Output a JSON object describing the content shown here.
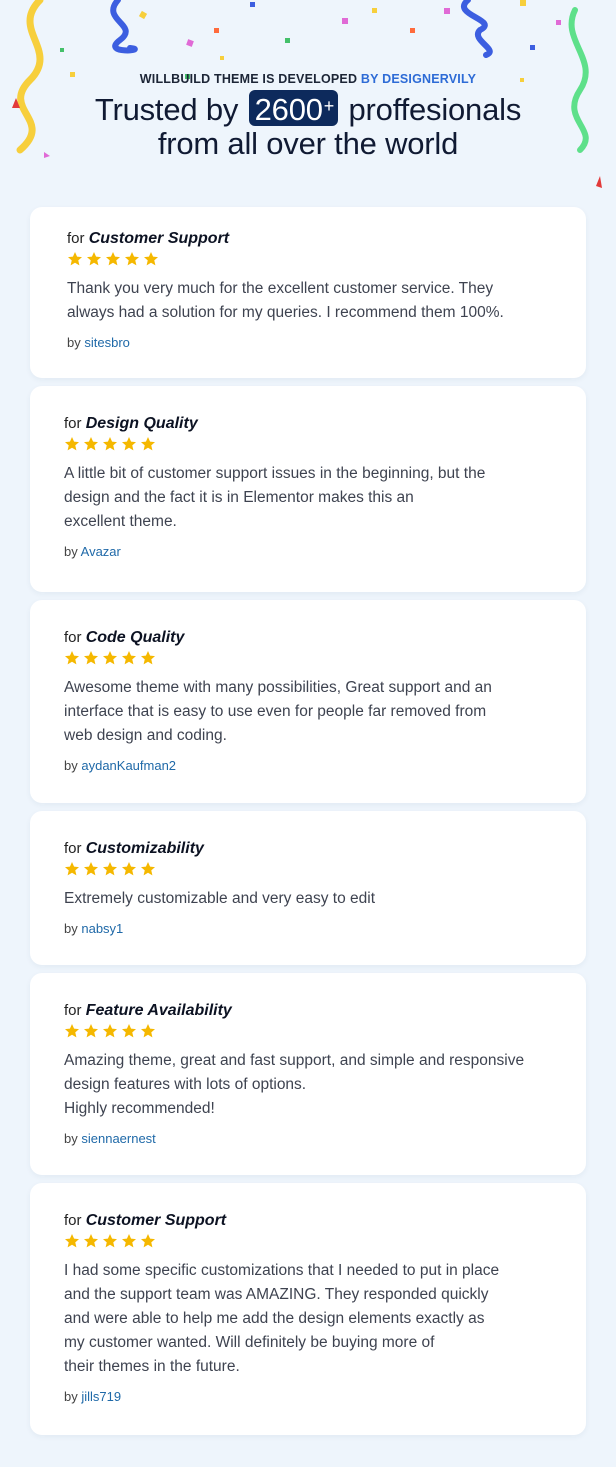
{
  "header": {
    "kicker_prefix": "WILLBUILD THEME IS DEVELOPED",
    "kicker_brand": "BY DESIGNERVILY",
    "headline_pre": "Trusted by",
    "badge_number": "2600",
    "badge_plus": "+",
    "headline_post": "proffesionals",
    "headline_line2": "from all over the world"
  },
  "colors": {
    "background": "#eef5fc",
    "accent_brand": "#2d6bd6",
    "badge_bg": "#0d2a5c",
    "star": "#f5b800",
    "author_link": "#1f69a8"
  },
  "by_prefix": "by",
  "for_prefix": "for",
  "reviews": [
    {
      "category": "Customer Support",
      "rating": 5,
      "text": "Thank you very much for the excellent customer service. They\nalways had a solution for my queries. I recommend them 100%.",
      "author": "sitesbro"
    },
    {
      "category": "Design Quality",
      "rating": 5,
      "text": "A little bit of customer support issues in the beginning, but the\ndesign and the fact it is in Elementor makes this an\nexcellent theme.",
      "author": "Avazar"
    },
    {
      "category": "Code Quality",
      "rating": 5,
      "text": "Awesome theme with many possibilities, Great support and an\ninterface that is easy to use even for people far removed from\nweb design and coding.",
      "author": "aydanKaufman2"
    },
    {
      "category": "Customizability",
      "rating": 5,
      "text": "Extremely customizable and very easy to edit",
      "author": "nabsy1"
    },
    {
      "category": "Feature Availability",
      "rating": 5,
      "text": "Amazing theme, great and fast support, and simple and responsive\ndesign features with lots of options.\nHighly recommended!",
      "author": "siennaernest"
    },
    {
      "category": "Customer Support",
      "rating": 5,
      "text": "I had some specific customizations that I needed to put in place\nand the support team was AMAZING. They responded quickly\nand were able to help me add the design elements exactly as\nmy customer wanted. Will definitely be buying more of\ntheir themes in the future.",
      "author": "jills719"
    }
  ]
}
